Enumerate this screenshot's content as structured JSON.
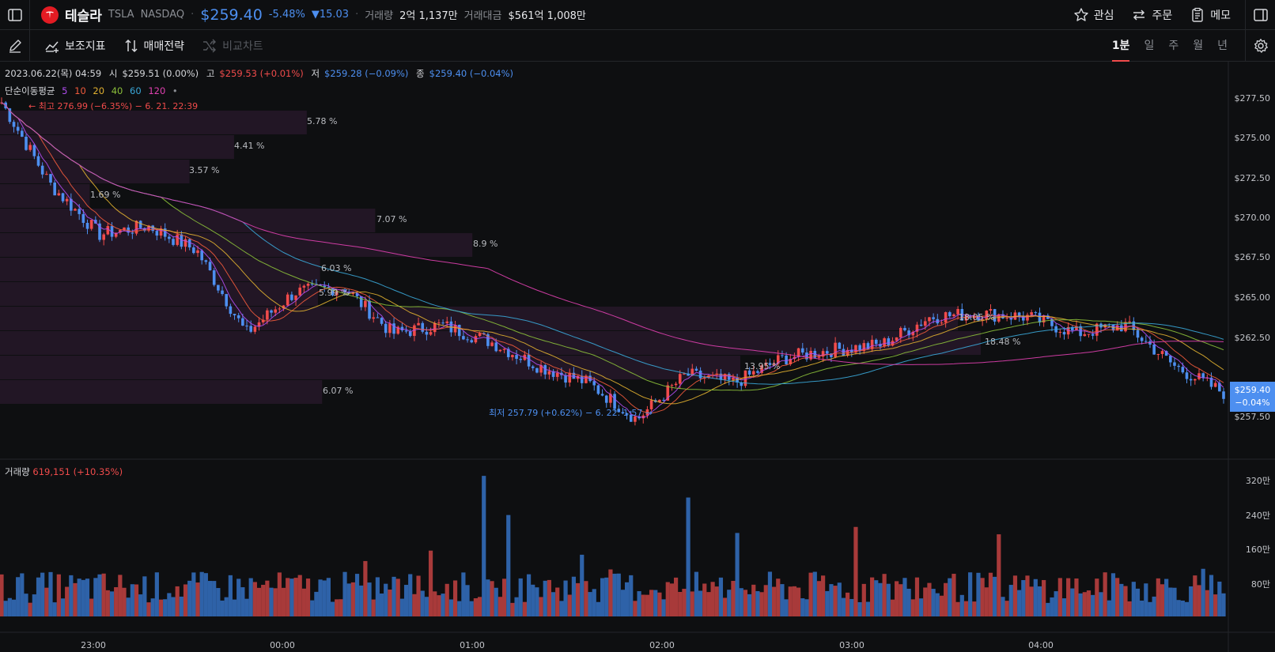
{
  "header": {
    "name": "테슬라",
    "symbol": "TSLA",
    "exchange": "NASDAQ",
    "price": "$259.40",
    "change_pct": "-5.48%",
    "change_abs": "15.03",
    "volume_label": "거래량",
    "volume_value": "2억 1,137만",
    "amount_label": "거래대금",
    "amount_value": "$561억 1,008만",
    "actions": {
      "watch": "관심",
      "order": "주문",
      "memo": "메모"
    }
  },
  "toolbar": {
    "indicators": "보조지표",
    "strategy": "매매전략",
    "compare": "비교차트",
    "periods": [
      "1분",
      "일",
      "주",
      "월",
      "년"
    ],
    "active_period": "1분"
  },
  "legend": {
    "date": "2023.06.22(목) 04:59",
    "open_label": "시",
    "open": "$259.51 (0.00%)",
    "high_label": "고",
    "high": "$259.53 (+0.01%)",
    "low_label": "저",
    "low": "$259.28 (−0.09%)",
    "close_label": "종",
    "close": "$259.40 (−0.04%)",
    "ma_label": "단순이동평균",
    "ma_periods": [
      "5",
      "10",
      "20",
      "40",
      "60",
      "120"
    ],
    "ma_colors": [
      "#b04cf0",
      "#f05a3c",
      "#e0b030",
      "#8bbf3a",
      "#3aa7d8",
      "#e040b0"
    ]
  },
  "annotations": {
    "high": "← 최고 276.99 (−6.35%) − 6. 21. 22:39",
    "low": "최저 257.79 (+0.62%) − 6. 22. 1:57 →"
  },
  "volume_profile": [
    "5.78 %",
    "4.41 %",
    "3.57 %",
    "1.69 %",
    "7.07 %",
    "8.9 %",
    "6.03 %",
    "5.99 %",
    "18.05 %",
    "18.48 %",
    "13.95 %",
    "6.07 %"
  ],
  "price_axis": [
    "$277.50",
    "$275.00",
    "$272.50",
    "$270.00",
    "$267.50",
    "$265.00",
    "$262.50",
    "$257.50"
  ],
  "current_price_tag": {
    "price": "$259.40",
    "pct": "−0.04%"
  },
  "volume": {
    "label": "거래량",
    "value": "619,151 (+10.35%)",
    "axis": [
      "320만",
      "240만",
      "160만",
      "80만"
    ]
  },
  "time_axis": [
    "23:00",
    "00:00",
    "01:00",
    "02:00",
    "03:00",
    "04:00"
  ],
  "colors": {
    "up": "#f04b4b",
    "down": "#4d8ff0",
    "background": "#0e0f11"
  },
  "chart_data": {
    "type": "line",
    "title": "",
    "x": [
      "22:39",
      "23:00",
      "23:15",
      "23:30",
      "23:45",
      "00:00",
      "00:15",
      "00:30",
      "00:45",
      "01:00",
      "01:15",
      "01:30",
      "01:45",
      "01:57",
      "02:15",
      "02:30",
      "02:45",
      "03:00",
      "03:15",
      "03:30",
      "03:45",
      "04:00",
      "04:15",
      "04:30",
      "04:45",
      "04:59"
    ],
    "series": [
      {
        "values": [
          276.99,
          272.0,
          269.0,
          269.5,
          268.0,
          263.0,
          265.5,
          265.8,
          263.0,
          263.5,
          262.5,
          261.0,
          260.0,
          257.79,
          260.5,
          260.0,
          261.5,
          262.0,
          262.3,
          264.0,
          264.2,
          264.0,
          263.0,
          263.5,
          261.0,
          259.4
        ]
      }
    ],
    "ylim": [
      256.0,
      278.5
    ],
    "volume_axis": [
      0,
      3200000
    ]
  }
}
